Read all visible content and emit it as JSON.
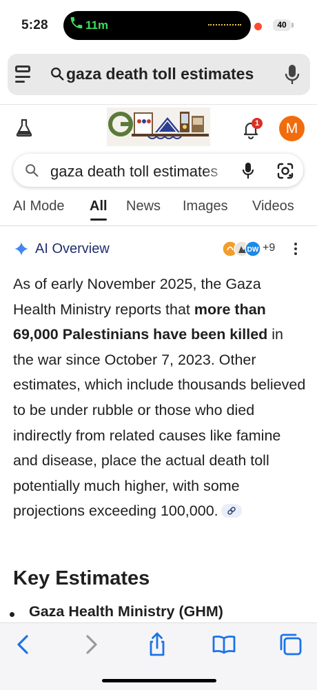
{
  "status_bar": {
    "time": "5:28",
    "call_duration": "11m",
    "battery": "40"
  },
  "browser": {
    "url_text": "gaza death toll estimates"
  },
  "google": {
    "notification_count": "1",
    "avatar_initial": "M",
    "search_query": "gaza death toll estimates",
    "tabs": [
      {
        "label": "AI Mode"
      },
      {
        "label": "All"
      },
      {
        "label": "News"
      },
      {
        "label": "Images"
      },
      {
        "label": "Videos"
      }
    ],
    "active_tab": "All"
  },
  "ai_overview": {
    "title": "AI Overview",
    "sources_more": "+9",
    "paragraph": {
      "p1": "As of early November 2025, the Gaza Health Ministry reports that ",
      "bold": "more than 69,000 Palestinians have been killed",
      "p2": " in the war since October 7, 2023. Other estimates, which include thousands believed to be under rubble or those who died indirectly from related causes like famine and disease, place the actual death toll potentially much higher, with some projections exceeding 100,000."
    },
    "key_estimates_heading": "Key Estimates",
    "bullets": [
      {
        "label": "Gaza Health Ministry (GHM)"
      }
    ]
  },
  "colors": {
    "accent_blue": "#1a73e8",
    "avatar_orange": "#f16c0c",
    "call_green": "#3fdc5c",
    "badge_red": "#d93025"
  }
}
